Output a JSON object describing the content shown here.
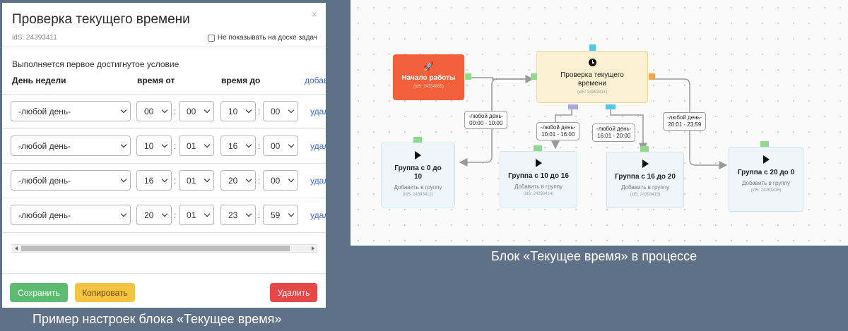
{
  "modal": {
    "title": "Проверка текущего времени",
    "ids": "idS: 24393411",
    "hide_label": "Не показывать на доске задач",
    "condition_text": "Выполняется первое достигнутое условие",
    "columns": {
      "day": "День недели",
      "time_from": "время от",
      "time_to": "время до",
      "add": "добавить"
    },
    "delete_row_label": "удалить",
    "rows": [
      {
        "day": "-любой день-",
        "from_h": "00",
        "from_m": "00",
        "to_h": "10",
        "to_m": "00"
      },
      {
        "day": "-любой день-",
        "from_h": "10",
        "from_m": "01",
        "to_h": "16",
        "to_m": "00"
      },
      {
        "day": "-любой день-",
        "from_h": "16",
        "from_m": "01",
        "to_h": "20",
        "to_m": "00"
      },
      {
        "day": "-любой день-",
        "from_h": "20",
        "from_m": "01",
        "to_h": "23",
        "to_m": "59"
      }
    ],
    "buttons": {
      "save": "Сохранить",
      "copy": "Копировать",
      "delete": "Удалить"
    }
  },
  "captions": {
    "left": "Пример настроек блока «Текущее время»",
    "right": "Блок «Текущее время» в процессе"
  },
  "diagram": {
    "start": {
      "title": "Начало работы",
      "ids": "(idS: 24334855)"
    },
    "check": {
      "title": "Проверка текущего времени",
      "ids": "(idS: 24393411)"
    },
    "groups": [
      {
        "title": "Группа с 0 до 10",
        "sub": "Добавить в группу",
        "ids": "(idS: 24393412)"
      },
      {
        "title": "Группа с 10 до 16",
        "sub": "Добавить в группу",
        "ids": "(idS: 24393414)"
      },
      {
        "title": "Группа с 16 до 20",
        "sub": "Добавить в группу",
        "ids": "(idS: 24393415)"
      },
      {
        "title": "Группа с 20 до 0",
        "sub": "Добавить в группу",
        "ids": "(idS: 24393416)"
      }
    ],
    "edges": [
      {
        "line1": "-любой день-",
        "line2": "00:00 - 10:00"
      },
      {
        "line1": "-любой день-",
        "line2": "10:01 - 16:00"
      },
      {
        "line1": "-любой день-",
        "line2": "16:01 - 20:00"
      },
      {
        "line1": "-любой день-",
        "line2": "20:01 - 23:59"
      }
    ],
    "colors": {
      "start": "#f1603b",
      "check": "#fbf1d2",
      "group": "#eef6fb",
      "port_green": "#8fd98a",
      "port_blue": "#54c3ee",
      "port_purple": "#a9a6e6",
      "port_orange": "#f5a54a"
    }
  }
}
